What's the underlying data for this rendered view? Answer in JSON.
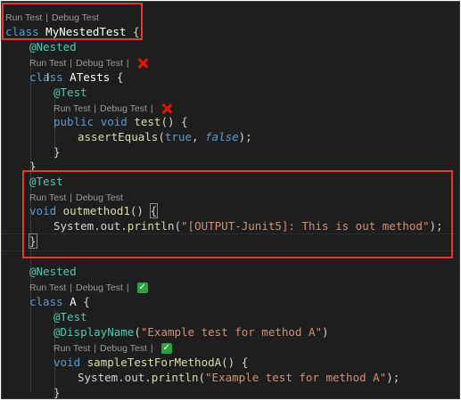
{
  "codelens": {
    "run": "Run Test",
    "debug": "Debug Test",
    "sep": "|"
  },
  "code": {
    "class_kw": "class",
    "class_name": "MyNestedTest",
    "open_brace": "{",
    "close_brace": "}",
    "nested_ann": "@Nested",
    "atests_name": "ATests",
    "test_ann": "@Test",
    "public_kw": "public",
    "void_kw": "void",
    "test_method": "test",
    "parens_open": "() {",
    "assert_fn": "assertEquals",
    "true_kw": "true",
    "false_kw": "false",
    "outmethod_name": "outmethod1",
    "parens": "()",
    "system_out": "System.out.",
    "println": "println",
    "out_string": "\"[OUTPUT-Junit5]: This is out method\"",
    "a_name": "A",
    "display_ann": "@DisplayName",
    "display_string": "\"Example test for method A\"",
    "sample_method": "sampleTestForMethodA",
    "sample_string": "\"Example test for method A\"",
    "close_paren_semi": ");"
  },
  "status": {
    "failed_icon": "x-mark-icon",
    "passed_icon": "check-mark-icon",
    "check_glyph": "✓"
  },
  "colors": {
    "highlight_box": "#e53935",
    "fail": "#e51400",
    "pass": "#2ea043"
  }
}
